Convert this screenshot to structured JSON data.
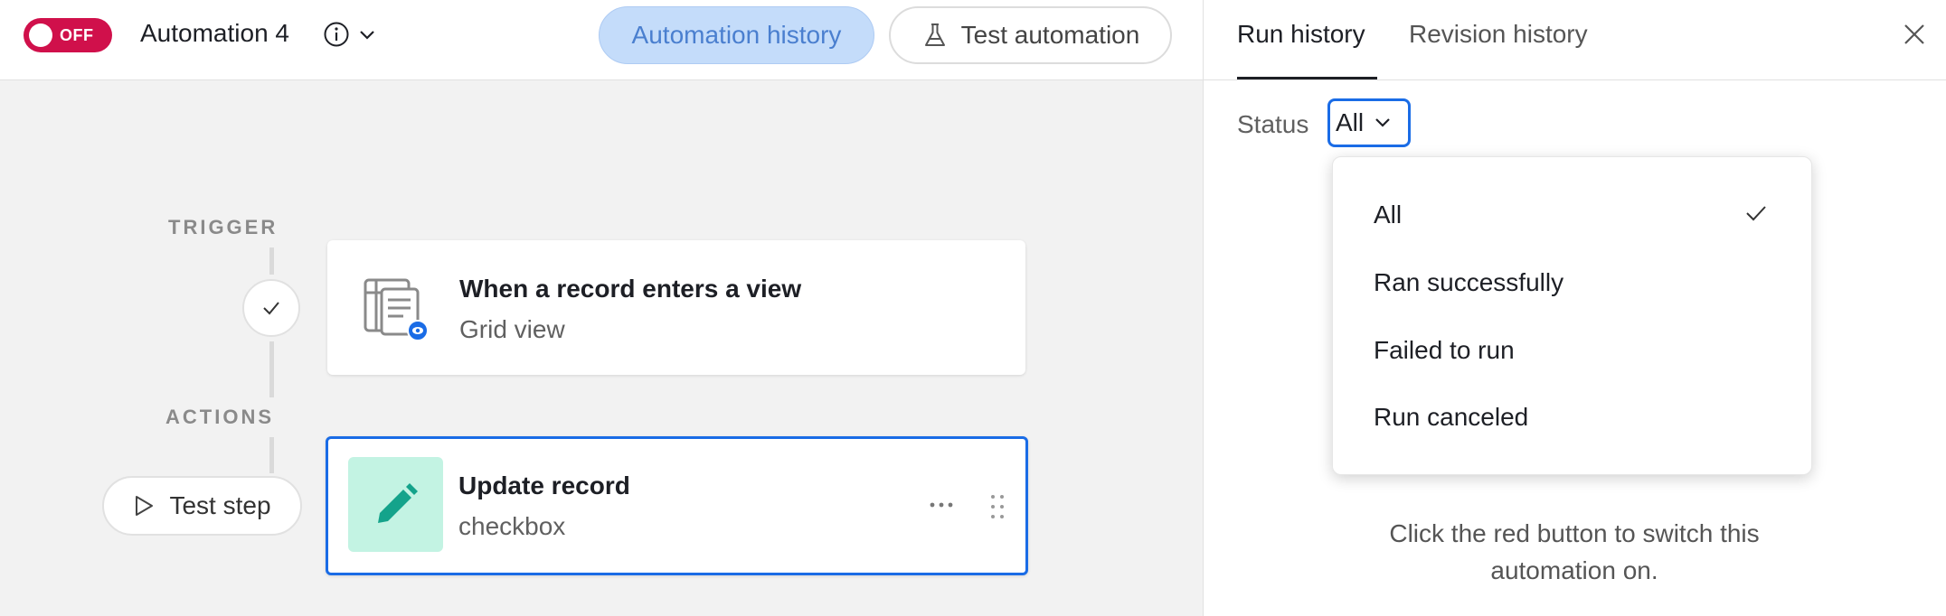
{
  "header": {
    "toggle_label": "OFF",
    "automation_name": "Automation 4",
    "history_button": "Automation history",
    "test_button": "Test automation"
  },
  "canvas": {
    "trigger_section": "TRIGGER",
    "actions_section": "ACTIONS",
    "trigger_card": {
      "title": "When a record enters a view",
      "subtitle": "Grid view"
    },
    "action_card": {
      "title": "Update record",
      "subtitle": "checkbox"
    },
    "test_step_label": "Test step"
  },
  "panel": {
    "tabs": [
      {
        "label": "Run history",
        "active": true
      },
      {
        "label": "Revision history",
        "active": false
      }
    ],
    "status_label": "Status",
    "status_value": "All",
    "dropdown": {
      "options": [
        {
          "label": "All",
          "selected": true
        },
        {
          "label": "Ran successfully",
          "selected": false
        },
        {
          "label": "Failed to run",
          "selected": false
        },
        {
          "label": "Run canceled",
          "selected": false
        }
      ]
    },
    "message": "Click the red button to switch this automation on."
  },
  "colors": {
    "toggle_off": "#d0104b",
    "accent_blue": "#1a6ce6",
    "history_button_bg": "#c4dcfa",
    "action_icon_bg": "#c3f3e3",
    "action_icon_fg": "#14a38b"
  }
}
